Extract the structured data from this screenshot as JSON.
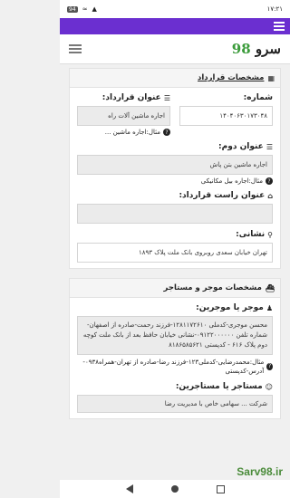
{
  "status": {
    "time": "۱۷:۲۱",
    "battery": "94"
  },
  "app": {
    "logo_text": "سرو",
    "logo_num": "98"
  },
  "contract_card": {
    "title": "مشخصات قرارداد",
    "number_label": "شماره:",
    "number_value": "۱۴۰۴۰۶۳۰۱۷۳۰۴۸",
    "title_label": "عنوان قرارداد:",
    "title_value": "اجاره ماشین آلات راه",
    "title_hint": "مثال:اجاره ماشین ...",
    "second_title_label": "عنوان دوم:",
    "second_title_value": "اجاره ماشین بتن پاش",
    "second_title_hint": "مثال:اجاره بیل مکانیکی",
    "right_title_label": "عنوان راست قرارداد:",
    "right_title_value": "",
    "address_label": "نشانی:",
    "address_value": "تهران خیابان سعدی روبروی بانک ملت پلاک ۱۸۹۳"
  },
  "parties_card": {
    "title": "مشخصات موجر و مستاجر",
    "lessor_label": "موجر یا موجرین:",
    "lessor_value": "محسن موجری-کدملی ۱۲۸۱۱۷۲۶۱۰-فرزند رحمت-صادره از اصفهان-شماره تلفن ۰۹۱۲۲۰۰۰۰۰۰-نشانی خیابان حافظ بعد از بانک ملت کوچه دوم پلاک ۶۱۶ - کدپستی ۸۱۸۶۵۸۵۶۲۱",
    "lessor_hint": "مثال:محمدرضایی-کدملی۱۲۳-فرزند رضا-صادره از تهران-همراه۰۹۳۸-آدرس-کدپستی",
    "lessee_label": "مستاجر یا مستاجرین:",
    "lessee_value": "شرکت ... سهامی خاص با مدیریت رضا"
  },
  "watermark": "Sarv98.ir"
}
